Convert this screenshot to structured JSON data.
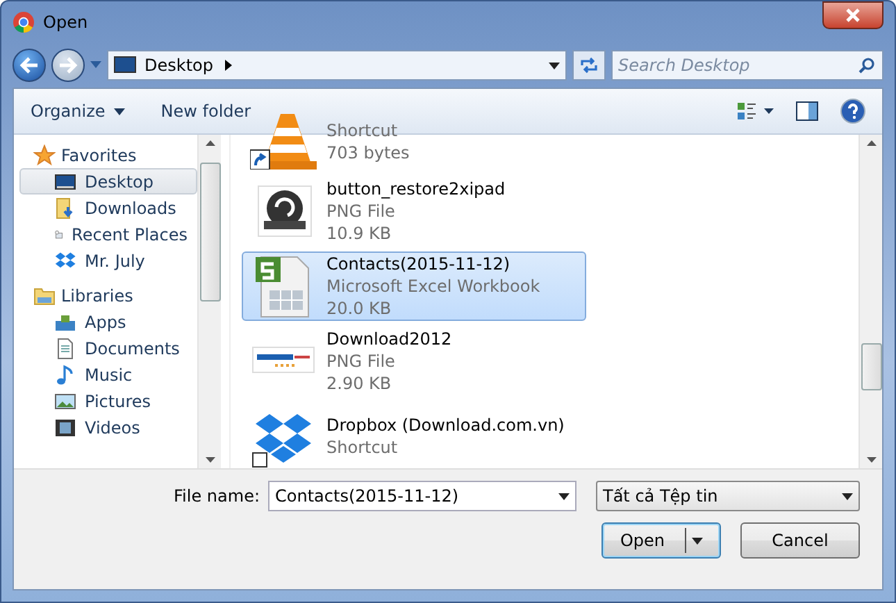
{
  "window": {
    "title": "Open"
  },
  "address": {
    "location": "Desktop"
  },
  "search": {
    "placeholder": "Search Desktop"
  },
  "toolbar": {
    "organize": "Organize",
    "new_folder": "New folder"
  },
  "sidebar": {
    "groups": [
      {
        "label": "Favorites",
        "kind": "favorites",
        "items": [
          {
            "label": "Desktop",
            "kind": "desktop",
            "selected": true
          },
          {
            "label": "Downloads",
            "kind": "downloads",
            "selected": false
          },
          {
            "label": "Recent Places",
            "kind": "recent",
            "selected": false
          },
          {
            "label": "Mr. July",
            "kind": "dropbox",
            "selected": false
          }
        ]
      },
      {
        "label": "Libraries",
        "kind": "libraries",
        "items": [
          {
            "label": "Apps",
            "kind": "apps",
            "selected": false
          },
          {
            "label": "Documents",
            "kind": "documents",
            "selected": false
          },
          {
            "label": "Music",
            "kind": "music",
            "selected": false
          },
          {
            "label": "Pictures",
            "kind": "pictures",
            "selected": false
          },
          {
            "label": "Videos",
            "kind": "videos",
            "selected": false
          }
        ]
      }
    ]
  },
  "files": [
    {
      "kind": "vlc",
      "type": "Shortcut",
      "size": "703 bytes",
      "selected": false
    },
    {
      "kind": "restore",
      "name": "button_restore2xipad",
      "type": "PNG File",
      "size": "10.9 KB",
      "selected": false
    },
    {
      "kind": "excel",
      "name": "Contacts(2015-11-12)",
      "type": "Microsoft Excel Workbook",
      "size": "20.0 KB",
      "selected": true
    },
    {
      "kind": "logo",
      "name": "Download2012",
      "type": "PNG File",
      "size": "2.90 KB",
      "selected": false
    },
    {
      "kind": "dropbox",
      "name": "Dropbox (Download.com.vn)",
      "type": "Shortcut",
      "selected": false
    }
  ],
  "footer": {
    "file_name_label": "File name:",
    "file_name": "Contacts(2015-11-12)",
    "file_type": "Tất cả Tệp tin",
    "open": "Open",
    "cancel": "Cancel"
  }
}
